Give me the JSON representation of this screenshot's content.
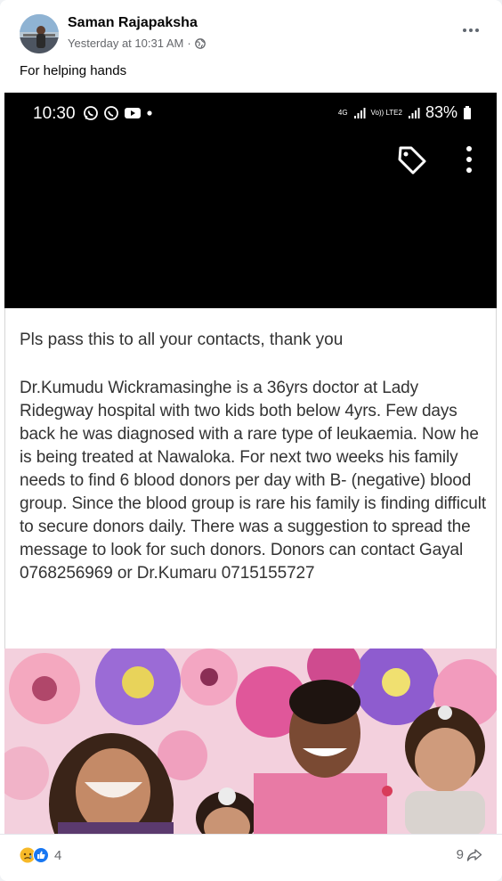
{
  "post": {
    "author": "Saman Rajapaksha",
    "timestamp": "Yesterday at 10:31 AM",
    "separator": "·",
    "privacy_icon": "globe-icon",
    "caption": "For helping hands"
  },
  "phone_status": {
    "time": "10:30",
    "network_label": "4G",
    "volte_label": "Vo)) LTE2",
    "battery_percent": "83%"
  },
  "message": {
    "title": "Pls pass this to all your contacts, thank you",
    "body": "Dr.Kumudu Wickramasinghe is a 36yrs doctor at Lady Ridegway hospital with two kids both below 4yrs. Few days back he was diagnosed with a rare type of leukaemia. Now he is being treated at Nawaloka. For next two weeks his family needs to find 6 blood donors per day with B- (negative) blood group. Since the blood group is rare his family is finding difficult to secure donors daily. There was a suggestion to spread the message  to look for such donors. Donors can contact Gayal  0768256969 or Dr.Kumaru 0715155727"
  },
  "footer": {
    "reaction_count": "4",
    "share_count": "9",
    "reaction_icons": [
      "sad-reaction-icon",
      "like-reaction-icon"
    ]
  },
  "colors": {
    "sad_reaction": "#f7b928",
    "like_reaction": "#1877f2"
  }
}
